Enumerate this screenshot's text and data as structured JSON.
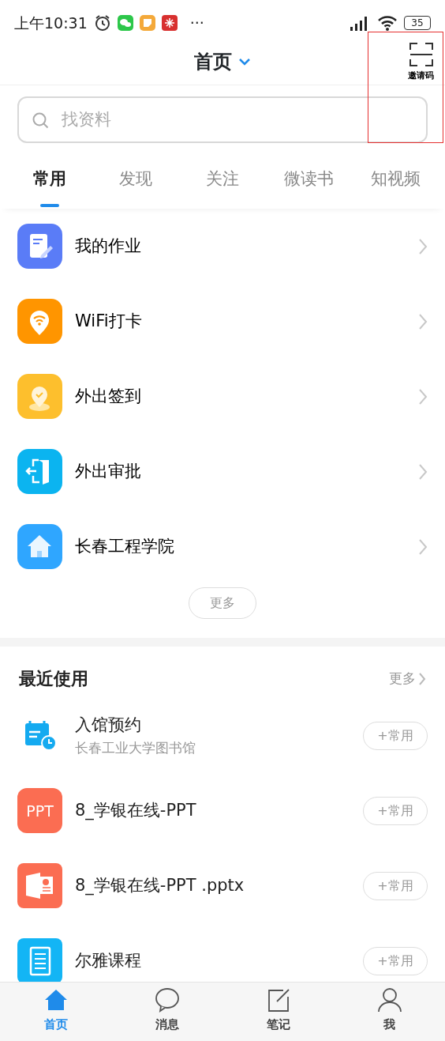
{
  "status_bar": {
    "time": "上午10:31",
    "more": "···",
    "battery": "35"
  },
  "header": {
    "title": "首页",
    "scan_label": "邀请码"
  },
  "search": {
    "placeholder": "找资料"
  },
  "tabs": [
    {
      "label": "常用",
      "selected": true
    },
    {
      "label": "发现",
      "selected": false
    },
    {
      "label": "关注",
      "selected": false
    },
    {
      "label": "微读书",
      "selected": false
    },
    {
      "label": "知视频",
      "selected": false
    }
  ],
  "favorites": [
    {
      "kind": "homework",
      "label": "我的作业"
    },
    {
      "kind": "wifi",
      "label": "WiFi打卡"
    },
    {
      "kind": "checkin",
      "label": "外出签到"
    },
    {
      "kind": "exit",
      "label": "外出审批"
    },
    {
      "kind": "school",
      "label": "长春工程学院"
    }
  ],
  "favorites_more": "更多",
  "recent": {
    "title": "最近使用",
    "more": "更多",
    "items": [
      {
        "kind": "calendar",
        "title": "入馆预约",
        "subtitle": "长春工业大学图书馆",
        "action": "+常用"
      },
      {
        "kind": "ppt",
        "icon_text": "PPT",
        "title": "8_学银在线-PPT",
        "action": "+常用"
      },
      {
        "kind": "pptx",
        "title": "8_学银在线-PPT .pptx",
        "action": "+常用"
      },
      {
        "kind": "doc",
        "title": "尔雅课程",
        "action": "+常用"
      }
    ]
  },
  "bottom_nav": [
    {
      "kind": "home",
      "label": "首页",
      "selected": true
    },
    {
      "kind": "chat",
      "label": "消息",
      "selected": false
    },
    {
      "kind": "note",
      "label": "笔记",
      "selected": false
    },
    {
      "kind": "user",
      "label": "我",
      "selected": false
    }
  ]
}
